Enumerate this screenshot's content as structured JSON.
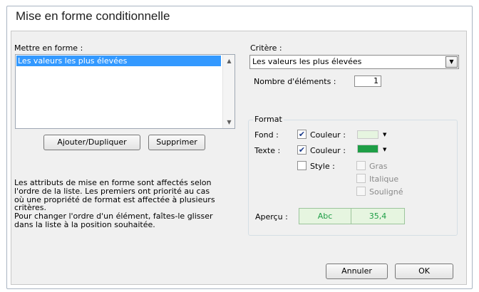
{
  "window": {
    "title": "Mise en forme conditionnelle"
  },
  "left": {
    "list_label": "Mettre en forme :",
    "list_items": [
      "Les valeurs les plus élevées"
    ],
    "add_button": "Ajouter/Dupliquer",
    "delete_button": "Supprimer",
    "info_lines": [
      "Les attributs de mise en forme sont affectés selon",
      "l'ordre de la liste. Les premiers ont priorité au cas",
      "où une propriété de format est affectée à plusieurs",
      "critères.",
      "Pour changer l'ordre d'un élément, faîtes-le glisser",
      "dans la liste à la position souhaitée."
    ]
  },
  "right": {
    "criteria_label": "Critère :",
    "criteria_value": "Les valeurs les plus élevées",
    "count_label": "Nombre d'éléments :",
    "count_value": "1",
    "format": {
      "group_label": "Format",
      "fill_label": "Fond :",
      "fill_color_label": "Couleur :",
      "fill_checked": true,
      "fill_color": "#e6f5e0",
      "text_label": "Texte :",
      "text_color_label": "Couleur :",
      "text_checked": true,
      "text_color": "#1e9e46",
      "style_label": "Style :",
      "style_checked": false,
      "style_options": [
        "Gras",
        "Italique",
        "Souligné"
      ],
      "preview_label": "Aperçu :",
      "preview_text": "Abc",
      "preview_number": "35,4",
      "preview_text_color": "#1e9e46"
    }
  },
  "footer": {
    "cancel_button": "Annuler",
    "ok_button": "OK"
  },
  "icons": {
    "scroll_up": "▲",
    "scroll_down": "▼",
    "dropdown": "▼",
    "check": "✔"
  }
}
